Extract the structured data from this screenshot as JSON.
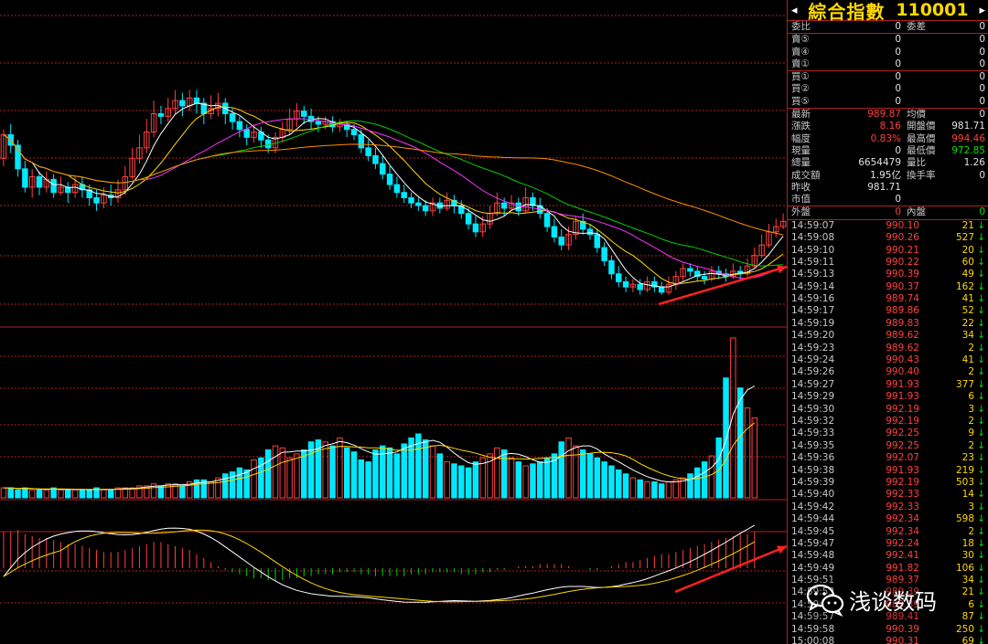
{
  "header": {
    "left_arrow": "◂",
    "title": "綜合指數",
    "code": "110001",
    "right_arrow": "▸"
  },
  "order_book": {
    "ratio_label": "委比",
    "ratio_value": "0",
    "diff_label": "委差",
    "diff_value": "0",
    "sells": [
      {
        "label": "賣⑤",
        "price": "0",
        "vol": "0"
      },
      {
        "label": "賣④",
        "price": "0",
        "vol": "0"
      },
      {
        "label": "賣①",
        "price": "0",
        "vol": "0"
      }
    ],
    "buys": [
      {
        "label": "買①",
        "price": "0",
        "vol": "0"
      },
      {
        "label": "買②",
        "price": "0",
        "vol": "0"
      },
      {
        "label": "買⑤",
        "price": "0",
        "vol": "0"
      }
    ]
  },
  "quote": [
    {
      "l1": "最新",
      "v1": "989.87",
      "c1": "red",
      "l2": "均價",
      "v2": "0",
      "c2": "wht"
    },
    {
      "l1": "漲跌",
      "v1": "8.16",
      "c1": "red",
      "l2": "開盤價",
      "v2": "981.71",
      "c2": "wht"
    },
    {
      "l1": "幅度",
      "v1": "0.83%",
      "c1": "red",
      "l2": "最高價",
      "v2": "994.46",
      "c2": "red"
    },
    {
      "l1": "現量",
      "v1": "0",
      "c1": "wht",
      "l2": "最低價",
      "v2": "972.85",
      "c2": "grn"
    },
    {
      "l1": "總量",
      "v1": "6654479",
      "c1": "wht",
      "l2": "量比",
      "v2": "1.26",
      "c2": "wht"
    },
    {
      "l1": "成交額",
      "v1": "1.95亿",
      "c1": "wht",
      "l2": "換手率",
      "v2": "0",
      "c2": "wht"
    },
    {
      "l1": "昨收",
      "v1": "981.71",
      "c1": "wht",
      "l2": "",
      "v2": "",
      "c2": "wht"
    },
    {
      "l1": "市值",
      "v1": "0",
      "c1": "wht",
      "l2": "",
      "v2": "",
      "c2": "wht"
    }
  ],
  "outer_label": "外盤",
  "outer_value": "0",
  "inner_label": "內盤",
  "inner_value": "0",
  "ticks": [
    {
      "t": "14:59:07",
      "p": "990.10",
      "q": "21",
      "d": "↓"
    },
    {
      "t": "14:59:08",
      "p": "990.26",
      "q": "527",
      "d": "↓"
    },
    {
      "t": "14:59:10",
      "p": "990.21",
      "q": "20",
      "d": "↓"
    },
    {
      "t": "14:59:11",
      "p": "990.22",
      "q": "60",
      "d": "↓"
    },
    {
      "t": "14:59:13",
      "p": "990.39",
      "q": "49",
      "d": "↓"
    },
    {
      "t": "14:59:14",
      "p": "990.37",
      "q": "162",
      "d": "↓"
    },
    {
      "t": "14:59:16",
      "p": "989.74",
      "q": "41",
      "d": "↓"
    },
    {
      "t": "14:59:17",
      "p": "989.86",
      "q": "52",
      "d": "↓"
    },
    {
      "t": "14:59:19",
      "p": "989.83",
      "q": "22",
      "d": "↓"
    },
    {
      "t": "14:59:20",
      "p": "989.62",
      "q": "34",
      "d": "↓"
    },
    {
      "t": "14:59:23",
      "p": "989.62",
      "q": "2",
      "d": "↓"
    },
    {
      "t": "14:59:24",
      "p": "990.43",
      "q": "41",
      "d": "↓"
    },
    {
      "t": "14:59:26",
      "p": "990.40",
      "q": "2",
      "d": "↓"
    },
    {
      "t": "14:59:27",
      "p": "991.93",
      "q": "377",
      "d": "↓"
    },
    {
      "t": "14:59:29",
      "p": "991.93",
      "q": "6",
      "d": "↓"
    },
    {
      "t": "14:59:30",
      "p": "992.19",
      "q": "3",
      "d": "↓"
    },
    {
      "t": "14:59:32",
      "p": "992.19",
      "q": "2",
      "d": "↓"
    },
    {
      "t": "14:59:33",
      "p": "992.25",
      "q": "9",
      "d": "↓"
    },
    {
      "t": "14:59:35",
      "p": "992.25",
      "q": "2",
      "d": "↓"
    },
    {
      "t": "14:59:36",
      "p": "992.07",
      "q": "23",
      "d": "↓"
    },
    {
      "t": "14:59:38",
      "p": "991.93",
      "q": "219",
      "d": "↓"
    },
    {
      "t": "14:59:39",
      "p": "992.19",
      "q": "503",
      "d": "↓"
    },
    {
      "t": "14:59:40",
      "p": "992.33",
      "q": "14",
      "d": "↓"
    },
    {
      "t": "14:59:42",
      "p": "992.33",
      "q": "3",
      "d": "↓"
    },
    {
      "t": "14:59:44",
      "p": "992.34",
      "q": "598",
      "d": "↓"
    },
    {
      "t": "14:59:45",
      "p": "992.34",
      "q": "2",
      "d": "↓"
    },
    {
      "t": "14:59:47",
      "p": "992.24",
      "q": "18",
      "d": "↓"
    },
    {
      "t": "14:59:48",
      "p": "992.41",
      "q": "30",
      "d": "↓"
    },
    {
      "t": "14:59:49",
      "p": "991.82",
      "q": "106",
      "d": "↓"
    },
    {
      "t": "14:59:51",
      "p": "989.37",
      "q": "34",
      "d": "↓"
    },
    {
      "t": "14:59:53",
      "p": "989.39",
      "q": "21",
      "d": "↓"
    },
    {
      "t": "14:59:55",
      "p": "989.39",
      "q": "6",
      "d": "↓"
    },
    {
      "t": "14:59:57",
      "p": "989.41",
      "q": "87",
      "d": "↓"
    },
    {
      "t": "14:59:58",
      "p": "990.39",
      "q": "250",
      "d": "↓"
    },
    {
      "t": "15:00:08",
      "p": "990.31",
      "q": "69",
      "d": "↓"
    }
  ],
  "watermark": {
    "text": "浅谈数码",
    "icon": "wechat-icon"
  },
  "colors": {
    "up": "#ff4040",
    "down": "#00e8ff",
    "grid": "#b02020",
    "ma5": "#ffffff",
    "ma10": "#ffd800",
    "ma20": "#ff30ff",
    "ma30": "#00d000",
    "ma60": "#ff8c00",
    "annotation": "#ff2020"
  },
  "chart_data": {
    "type": "candlestick",
    "candles": [
      [
        283,
        292,
        294,
        280
      ],
      [
        292,
        288,
        296,
        285
      ],
      [
        288,
        279,
        290,
        276
      ],
      [
        279,
        272,
        282,
        270
      ],
      [
        272,
        276,
        279,
        268
      ],
      [
        276,
        272,
        278,
        269
      ],
      [
        272,
        275,
        278,
        270
      ],
      [
        275,
        270,
        277,
        268
      ],
      [
        270,
        272,
        276,
        269
      ],
      [
        272,
        270,
        274,
        266
      ],
      [
        270,
        273,
        276,
        268
      ],
      [
        273,
        271,
        276,
        268
      ],
      [
        271,
        268,
        273,
        265
      ],
      [
        268,
        266,
        271,
        263
      ],
      [
        266,
        269,
        272,
        264
      ],
      [
        269,
        268,
        273,
        265
      ],
      [
        268,
        271,
        275,
        266
      ],
      [
        271,
        276,
        280,
        269
      ],
      [
        276,
        283,
        287,
        275
      ],
      [
        283,
        287,
        292,
        281
      ],
      [
        287,
        293,
        298,
        285
      ],
      [
        293,
        300,
        305,
        291
      ],
      [
        300,
        299,
        303,
        296
      ],
      [
        299,
        302,
        306,
        297
      ],
      [
        302,
        305,
        309,
        300
      ],
      [
        305,
        303,
        308,
        299
      ],
      [
        303,
        306,
        309,
        301
      ],
      [
        306,
        304,
        309,
        300
      ],
      [
        304,
        300,
        306,
        296
      ],
      [
        300,
        302,
        307,
        298
      ],
      [
        302,
        304,
        308,
        299
      ],
      [
        304,
        300,
        306,
        296
      ],
      [
        300,
        297,
        302,
        294
      ],
      [
        297,
        294,
        299,
        291
      ],
      [
        294,
        291,
        296,
        288
      ],
      [
        291,
        293,
        296,
        289
      ],
      [
        293,
        290,
        295,
        287
      ],
      [
        290,
        287,
        292,
        285
      ],
      [
        287,
        291,
        293,
        285
      ],
      [
        291,
        294,
        297,
        289
      ],
      [
        294,
        298,
        302,
        292
      ],
      [
        298,
        301,
        304,
        295
      ],
      [
        301,
        299,
        303,
        296
      ],
      [
        299,
        297,
        302,
        294
      ],
      [
        297,
        296,
        299,
        293
      ],
      [
        296,
        297,
        299,
        294
      ],
      [
        297,
        295,
        299,
        293
      ],
      [
        295,
        296,
        298,
        293
      ],
      [
        296,
        294,
        297,
        291
      ],
      [
        294,
        292,
        296,
        290
      ],
      [
        292,
        287,
        294,
        285
      ],
      [
        287,
        284,
        290,
        282
      ],
      [
        284,
        281,
        287,
        279
      ],
      [
        281,
        277,
        284,
        275
      ],
      [
        277,
        273,
        280,
        271
      ],
      [
        273,
        270,
        276,
        268
      ],
      [
        270,
        268,
        273,
        266
      ],
      [
        268,
        266,
        270,
        264
      ],
      [
        266,
        265,
        268,
        263
      ],
      [
        265,
        263,
        267,
        261
      ],
      [
        263,
        266,
        268,
        261
      ],
      [
        266,
        264,
        268,
        262
      ],
      [
        264,
        267,
        270,
        263
      ],
      [
        267,
        265,
        269,
        262
      ],
      [
        265,
        262,
        267,
        260
      ],
      [
        262,
        258,
        264,
        256
      ],
      [
        258,
        255,
        261,
        253
      ],
      [
        255,
        258,
        261,
        253
      ],
      [
        258,
        262,
        265,
        256
      ],
      [
        262,
        266,
        270,
        261
      ],
      [
        266,
        264,
        268,
        261
      ],
      [
        264,
        266,
        269,
        263
      ],
      [
        266,
        263,
        268,
        261
      ],
      [
        263,
        268,
        272,
        262
      ],
      [
        268,
        265,
        270,
        263
      ],
      [
        265,
        262,
        268,
        260
      ],
      [
        262,
        257,
        264,
        255
      ],
      [
        257,
        253,
        260,
        251
      ],
      [
        253,
        250,
        256,
        248
      ],
      [
        250,
        254,
        257,
        248
      ],
      [
        254,
        259,
        261,
        252
      ],
      [
        259,
        256,
        262,
        254
      ],
      [
        256,
        254,
        258,
        252
      ],
      [
        254,
        249,
        256,
        247
      ],
      [
        249,
        244,
        251,
        242
      ],
      [
        244,
        239,
        246,
        237
      ],
      [
        239,
        236,
        242,
        234
      ],
      [
        236,
        234,
        238,
        232
      ],
      [
        234,
        235,
        237,
        232
      ],
      [
        235,
        233,
        237,
        231
      ],
      [
        233,
        236,
        238,
        232
      ],
      [
        236,
        234,
        238,
        232
      ],
      [
        234,
        232,
        236,
        231
      ],
      [
        232,
        235,
        238,
        231
      ],
      [
        235,
        238,
        240,
        233
      ],
      [
        238,
        241,
        243,
        236
      ],
      [
        241,
        240,
        243,
        238
      ],
      [
        240,
        238,
        242,
        236
      ],
      [
        238,
        237,
        240,
        235
      ],
      [
        237,
        240,
        242,
        236
      ],
      [
        240,
        239,
        242,
        237
      ],
      [
        239,
        238,
        241,
        236
      ],
      [
        238,
        240,
        243,
        237
      ],
      [
        240,
        239,
        242,
        237
      ],
      [
        239,
        242,
        245,
        238
      ],
      [
        242,
        246,
        249,
        241
      ],
      [
        246,
        250,
        254,
        245
      ],
      [
        250,
        255,
        258,
        249
      ],
      [
        255,
        257,
        260,
        253
      ],
      [
        257,
        259,
        262,
        256
      ]
    ],
    "volume": [
      5,
      5,
      4,
      5,
      4,
      4,
      4,
      5,
      4,
      4,
      4,
      4,
      4,
      5,
      4,
      4,
      5,
      5,
      5,
      6,
      6,
      7,
      6,
      7,
      7,
      6,
      8,
      9,
      9,
      8,
      10,
      12,
      13,
      15,
      14,
      19,
      20,
      24,
      26,
      25,
      20,
      22,
      24,
      28,
      29,
      28,
      26,
      30,
      25,
      23,
      19,
      18,
      24,
      26,
      25,
      22,
      27,
      30,
      32,
      29,
      26,
      22,
      18,
      17,
      16,
      15,
      18,
      20,
      22,
      25,
      24,
      20,
      18,
      16,
      17,
      18,
      20,
      22,
      28,
      30,
      26,
      24,
      22,
      20,
      18,
      16,
      14,
      12,
      10,
      9,
      8,
      8,
      7,
      8,
      9,
      10,
      12,
      15,
      18,
      21,
      30,
      60,
      80,
      55,
      45,
      40
    ],
    "macd_hist": [
      18,
      18,
      19,
      17,
      16,
      15,
      15,
      14,
      13,
      12,
      12,
      11,
      10,
      9,
      8,
      8,
      8,
      9,
      10,
      11,
      12,
      13,
      13,
      12,
      11,
      10,
      9,
      7,
      5,
      3,
      1,
      -1,
      -2,
      -3,
      -4,
      -5,
      -5,
      -6,
      -6,
      -6,
      -5,
      -5,
      -4,
      -4,
      -3,
      -3,
      -3,
      -2,
      -2,
      -2,
      -3,
      -3,
      -4,
      -4,
      -4,
      -4,
      -4,
      -3,
      -3,
      -3,
      -2,
      -2,
      -2,
      -2,
      -3,
      -3,
      -3,
      -2,
      -2,
      -1,
      -1,
      0,
      1,
      1,
      1,
      2,
      2,
      2,
      2,
      1,
      0,
      0,
      -1,
      -1,
      0,
      1,
      2,
      3,
      3,
      4,
      5,
      6,
      7,
      7,
      8,
      9,
      10,
      11,
      12,
      13,
      14,
      15,
      16,
      17,
      17,
      18
    ],
    "annotations": [
      "arrow-to-price-panel",
      "arrow-to-tick-list",
      "trend-arrow-price",
      "trend-arrow-macd"
    ]
  }
}
